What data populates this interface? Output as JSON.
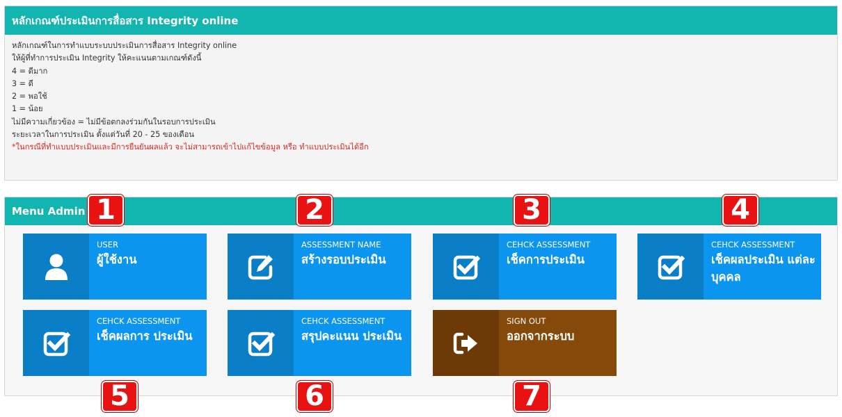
{
  "criteria": {
    "title": "หลักเกณฑ์ประเมินการสื่อสาร Integrity online",
    "lines": [
      "หลักเกณฑ์ในการทำแบบระบบประเมินการสื่อสาร Integrity online",
      "ให้ผู้ที่ทำการประเมิน Integrity ให้คะแนนตามเกณฑ์ดังนี้",
      "4 = ดีมาก",
      "3 = ดี",
      "2 = พอใช้",
      "1 = น้อย",
      "ไม่มีความเกี่ยวข้อง = ไม่มีข้อตกลงร่วมกันในรอบการประเมิน",
      "ระยะเวลาในการประเมิน ตั้งแต่วันที่ 20 - 25 ของเดือน"
    ],
    "warning": "*ในกรณีที่ทำแบบประเมินและมีการยืนยันผลแล้ว จะไม่สามารถเข้าไปแก้ไขข้อมูล หรือ ทำแบบประเมินได้อีก"
  },
  "menu": {
    "title": "Menu Admin",
    "tiles": [
      {
        "sub": "USER",
        "main": "ผู้ใช้งาน",
        "icon": "user-icon"
      },
      {
        "sub": "ASSESSMENT NAME",
        "main": "สร้างรอบประเมิน",
        "icon": "edit-icon"
      },
      {
        "sub": "CEHCK ASSESSMENT",
        "main": "เช็คการประเมิน",
        "icon": "check-square-icon"
      },
      {
        "sub": "CEHCK ASSESSMENT",
        "main": "เช็คผลประเมิน แต่ละบุคคล",
        "icon": "check-square-icon"
      },
      {
        "sub": "CEHCK ASSESSMENT",
        "main": "เช็คผลการ ประเมิน",
        "icon": "check-square-icon"
      },
      {
        "sub": "CEHCK ASSESSMENT",
        "main": "สรุปคะแนน ประเมิน",
        "icon": "check-square-icon"
      },
      {
        "sub": "SIGN OUT",
        "main": "ออกจากระบบ",
        "icon": "sign-out-icon"
      }
    ]
  },
  "badges": [
    "1",
    "2",
    "3",
    "4",
    "5",
    "6",
    "7"
  ],
  "colors": {
    "header": "#12b5b0",
    "tile_icon_blue": "#0a7ec7",
    "tile_text_blue": "#0b95ef",
    "tile_icon_brown": "#6d3a07",
    "tile_text_brown": "#854a0a",
    "warning": "#e0261f",
    "badge": "#e81212"
  }
}
